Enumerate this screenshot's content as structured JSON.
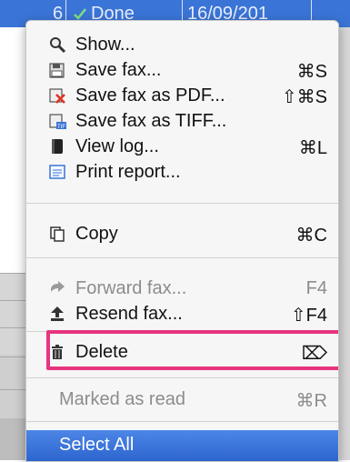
{
  "background_row": {
    "count": "6",
    "status": "Done",
    "date": "16/09/201"
  },
  "menu": {
    "items": [
      {
        "label": "Show...",
        "shortcut": "",
        "icon": "magnifier-icon"
      },
      {
        "label": "Save fax...",
        "shortcut": "⌘S",
        "icon": "save-fax-icon"
      },
      {
        "label": "Save fax as PDF...",
        "shortcut": "⇧⌘S",
        "icon": "pdf-icon"
      },
      {
        "label": "Save fax as TIFF...",
        "shortcut": "",
        "icon": "tiff-icon"
      },
      {
        "label": "View log...",
        "shortcut": "⌘L",
        "icon": "log-book-icon"
      },
      {
        "label": "Print report...",
        "shortcut": "",
        "icon": "report-icon"
      },
      {
        "label": "Copy",
        "shortcut": "⌘C",
        "icon": "copy-icon"
      },
      {
        "label": "Forward fax...",
        "shortcut": "F4",
        "icon": "forward-icon"
      },
      {
        "label": "Resend fax...",
        "shortcut": "⇧F4",
        "icon": "resend-icon"
      },
      {
        "label": "Delete",
        "shortcut": "⌦",
        "icon": "trash-icon"
      },
      {
        "label": "Marked as read",
        "shortcut": "⌘R",
        "icon": ""
      },
      {
        "label": "Select All",
        "shortcut": "",
        "icon": ""
      }
    ]
  },
  "colors": {
    "selection": "#3a74d6",
    "highlight_box": "#e7347e"
  }
}
